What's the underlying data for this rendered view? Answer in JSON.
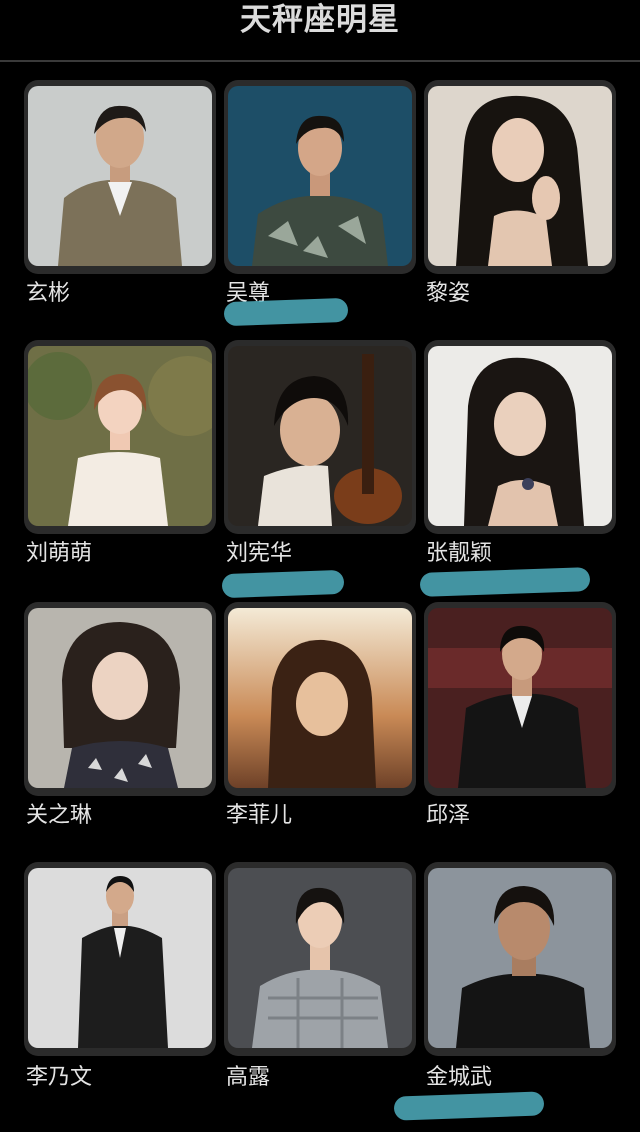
{
  "header": {
    "title": "天秤座明星"
  },
  "stars": [
    {
      "name": "玄彬"
    },
    {
      "name": "吴尊"
    },
    {
      "name": "黎姿"
    },
    {
      "name": "刘萌萌"
    },
    {
      "name": "刘宪华"
    },
    {
      "name": "张靓颖"
    },
    {
      "name": "关之琳"
    },
    {
      "name": "李菲儿"
    },
    {
      "name": "邱泽"
    },
    {
      "name": "李乃文"
    },
    {
      "name": "高露"
    },
    {
      "name": "金城武"
    }
  ]
}
